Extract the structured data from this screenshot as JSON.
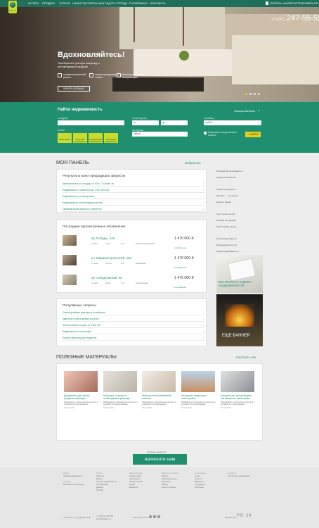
{
  "nav": {
    "items": [
      "КУПИТЬ",
      "ПРОДАТЬ",
      "УСЛУГИ",
      "НАШИ ПАРТНЕРЫ",
      "НАШ ГИД ПО ГОРОДУ",
      "О КОМПАНИИ",
      "КОНТАКТЫ"
    ],
    "login": "ВОЙТИ",
    "or": "или",
    "register": "ЗАРЕГИСТРИРОВАТЬСЯ",
    "logo_text": "Регион"
  },
  "hero": {
    "phone_code": "+7 (351)",
    "phone": "247-55-55",
    "title": "Вдохновляйтесь!",
    "subtitle": "Приобретите уютную квартиру с неповторимой скидкой!",
    "features": [
      "профессиональный ремонт",
      "низкая процентная ставка",
      "бесплатная бизнес-консультация"
    ],
    "button": "УЗНАТЬ БОЛЬШЕ"
  },
  "search": {
    "title": "Найти недвижимость",
    "extended": "Расширенный поиск",
    "labels": {
      "city": "по адресу",
      "rooms": "по цене (руб.)",
      "area": "по району",
      "type": "тип сделки",
      "region": "регион"
    },
    "city_value": "",
    "price_from": "от",
    "price_to": "до",
    "area_value": "любой",
    "type_value": "любая",
    "subregion_value": "любой",
    "checkbox": "Показывать предложения в области",
    "categories": [
      "Новостройки",
      "Вторичная недвижимость",
      "Коммерческая недвижимость",
      "Загородная недвижимость"
    ],
    "find": "НАЙТИ"
  },
  "panel": {
    "title": "МОЯ ПАНЕЛЬ",
    "favorites": "Избранное"
  },
  "results": {
    "title": "Результаты моих предыдущих запросов",
    "items": [
      "Центральный р-н, площадь от 40 м², 3-4 комн. кв.",
      "Недвижимость стоимостью до 2 500 000 руб.",
      "Недвижимость в новостройках",
      "Недвижимость на загородном участке",
      "Однокомнатная квартира с ремонтом"
    ]
  },
  "recent": {
    "title": "Последние просмотренные объявления",
    "listings": [
      {
        "title": "пр. Победы, 142",
        "rooms": "3 комн.",
        "area": "55 м²",
        "floor": "5 эт.",
        "district": "Тракторозаводский",
        "price": "1 470 000 ₽",
        "fav": "в избранное"
      },
      {
        "title": "ул. Машиностроителей, 15а",
        "rooms": "1 комн.",
        "area": "41,2 м²",
        "floor": "3 эт.",
        "district": "Ленинский",
        "price": "1 470 000 ₽",
        "fav": "в избранное"
      },
      {
        "title": "пр. Свердловский, 28",
        "rooms": "2 комн.",
        "area": "46 м²",
        "floor": "5 эт.",
        "district": "Калининский",
        "price": "1 470 000 ₽",
        "fav": "в избранное"
      }
    ]
  },
  "popular": {
    "title": "Популярные запросы",
    "items": [
      "Самые дешёвые квартиры в Челябинске",
      "Квартиры в новостройках в центре",
      "Элитное жильё по цене от 6 000 000",
      "Недвижимость в пригороде",
      "Лучшие квартиры для студентов"
    ]
  },
  "sidebar": {
    "items": [
      "Руководство пользователя",
      "Подача объявления",
      "Ответы на вопросы",
      "Ипотека — это просто",
      "Акции и скидки",
      "Ход строительства",
      "Отзывы на продажу",
      "Новостройки города",
      "Планировки квартир",
      "Юридические услуги",
      "Оценка недвижимости"
    ],
    "banner1": "БЕСПЛАТНАЯ ОЦЕНКА НЕДВИЖИМОСТИ",
    "banner2": "ЕЩЕ БАННЕР"
  },
  "useful": {
    "title": "ПОЛЕЗНЫЕ МАТЕРИАЛЫ",
    "all": "Смотреть все",
    "articles": [
      {
        "title": "Документы для купли-продажи квартиры",
        "date": "05 мая 2015"
      },
      {
        "title": "Квартира: покупка и необходимые расходы",
        "date": "05 мая 2015"
      },
      {
        "title": "Материнский (семейный) капитал",
        "date": "05 мая 2015"
      },
      {
        "title": "Как купить квартиру в новостройке",
        "date": "05 мая 2015"
      },
      {
        "title": "Банкротство застройщика: как защитить свои права",
        "date": "05 мая 2015"
      }
    ],
    "article_text": "Информация о материнском капитале и условиях его использования."
  },
  "cta": {
    "question": "Остались вопросы?",
    "button": "напишите нам"
  },
  "footer": {
    "cols": [
      {
        "head": "Купить",
        "items": [
          "Новая недвижимость",
          "Продать",
          "Выставить на продажу"
        ]
      },
      {
        "head": "Услуги",
        "items": [
          "Ипотека",
          "Юрист",
          "Оценка недвижимости",
          "Страхование",
          "Дизайн",
          "Отзывы"
        ]
      },
      {
        "head": "Наши проекты",
        "items": [
          "Новостройки",
          "Загородные",
          "Коммерческие",
          "Акции",
          "Вакансии"
        ]
      },
      {
        "head": "Наш гид по городу",
        "items": [
          "Районы",
          "Инфраструктура",
          "Транспорт",
          "Школы",
          "Новости рынка"
        ]
      },
      {
        "head": "О компании",
        "items": [
          "О нас",
          "Новости",
          "Вакансии",
          "Сотрудники",
          "Партнеры"
        ]
      },
      {
        "head": "Контакты",
        "items": [
          "Контактная информация"
        ]
      }
    ],
    "address": "Челябинск, ул. Труда, 84, 215",
    "phone": "+7 (351) 247-55-55",
    "email": "group@region.ru",
    "social": "Мы в соц. сетях",
    "dev": "разработано",
    "dev_logo": "PR 24"
  },
  "colors": {
    "brand": "#1f8f70",
    "accent": "#c8dc2c",
    "button": "#e8cf1c"
  }
}
